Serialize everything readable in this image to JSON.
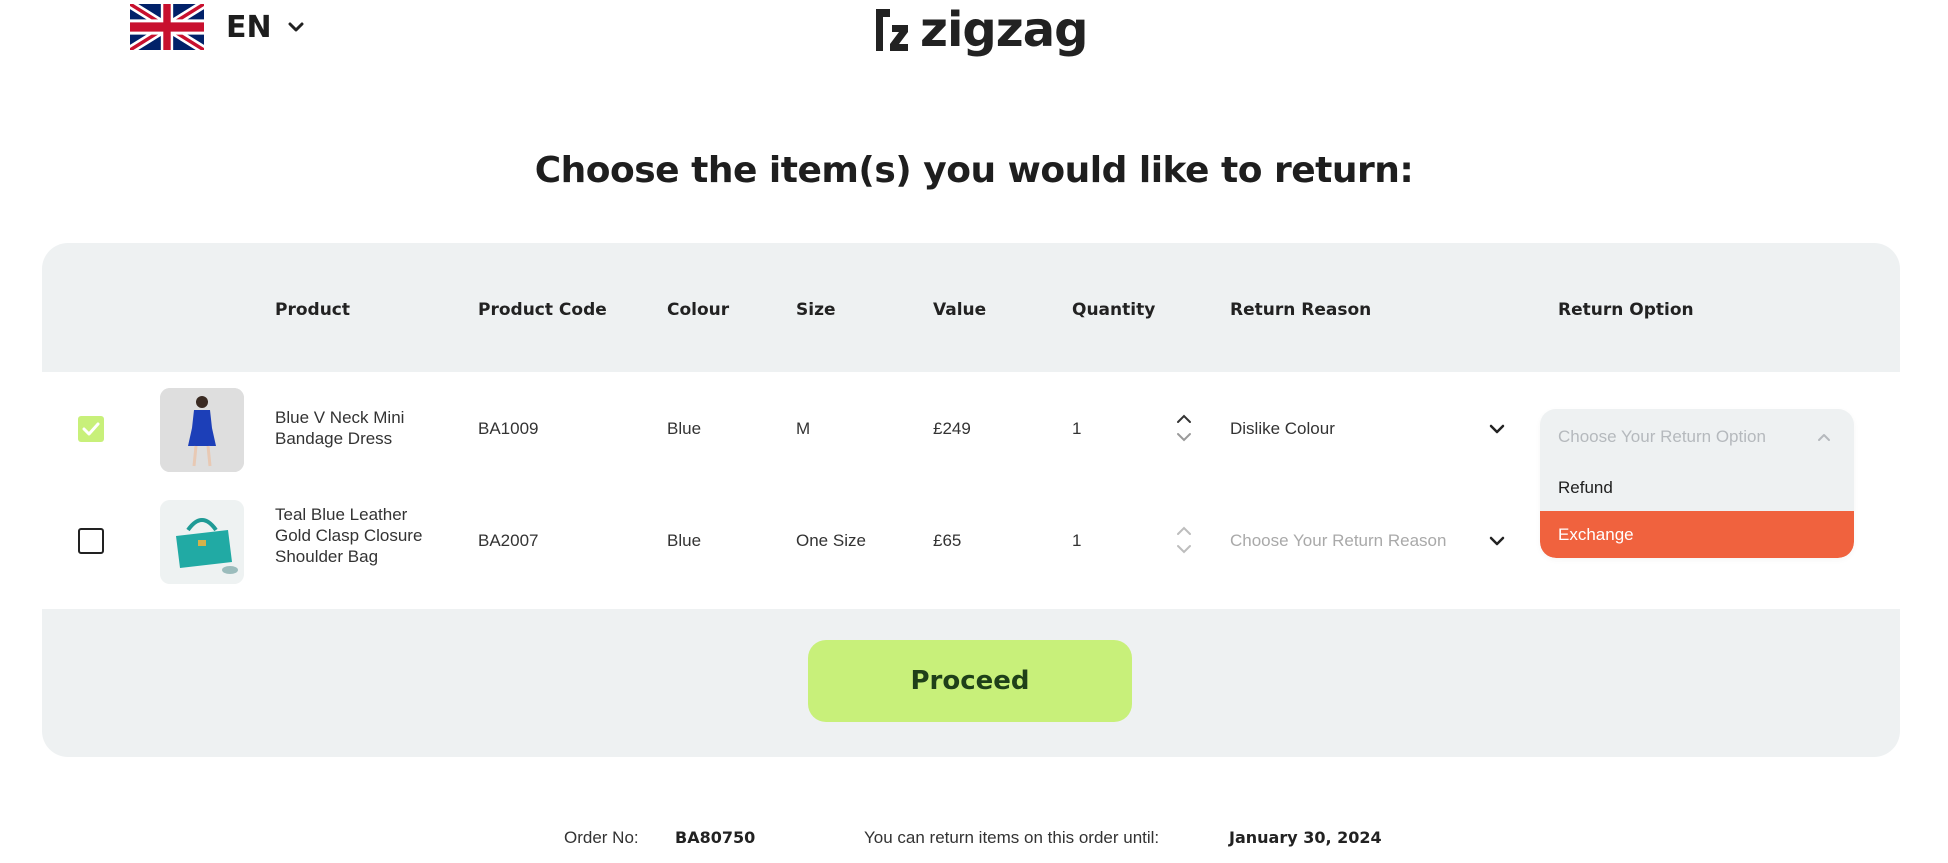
{
  "header": {
    "language_code": "EN",
    "brand": "zigzag"
  },
  "page_title": "Choose the item(s) you would like to return:",
  "table": {
    "columns": [
      "Product",
      "Product Code",
      "Colour",
      "Size",
      "Value",
      "Quantity",
      "Return Reason",
      "Return Option"
    ],
    "rows": [
      {
        "selected": true,
        "product": "Blue V Neck Mini Bandage Dress",
        "code": "BA1009",
        "colour": "Blue",
        "size": "M",
        "value": "£249",
        "quantity": "1",
        "return_reason": "Dislike Colour",
        "return_option_placeholder": "Choose Your Return Option"
      },
      {
        "selected": false,
        "product": "Teal Blue Leather Gold Clasp Closure Shoulder Bag",
        "code": "BA2007",
        "colour": "Blue",
        "size": "One Size",
        "value": "£65",
        "quantity": "1",
        "return_reason_placeholder": "Choose Your Return Reason"
      }
    ]
  },
  "return_option_dropdown": {
    "placeholder": "Choose Your Return Option",
    "options": [
      "Refund",
      "Exchange"
    ],
    "highlighted": "Exchange"
  },
  "proceed_label": "Proceed",
  "footer": {
    "order_no_label": "Order No:",
    "order_no": "BA80750",
    "return_until_label": "You can return items on this order until:",
    "return_until_date": "January 30, 2024"
  },
  "colors": {
    "accent_green": "#c8f07a",
    "highlight_orange": "#f0623e",
    "card_bg": "#eef1f2"
  }
}
